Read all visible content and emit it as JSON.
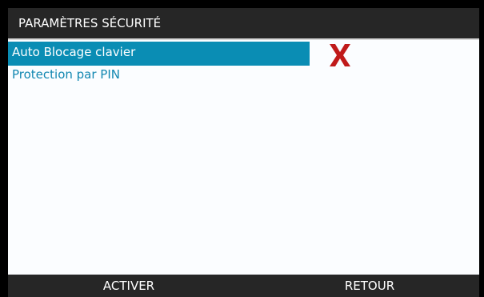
{
  "header": {
    "title": "PARAMÈTRES SÉCURITÉ"
  },
  "menu": {
    "items": [
      {
        "label": "Auto Blocage clavier",
        "selected": true,
        "status": "disabled",
        "status_icon": "red-x-icon"
      },
      {
        "label": "Protection par PIN",
        "selected": false
      }
    ]
  },
  "footer": {
    "left_softkey": "ACTIVER",
    "right_softkey": "RETOUR"
  },
  "colors": {
    "header_bg": "#262626",
    "selection": "#0a8db4",
    "item_text": "#1187b1",
    "status_x": "#c01a1a"
  }
}
